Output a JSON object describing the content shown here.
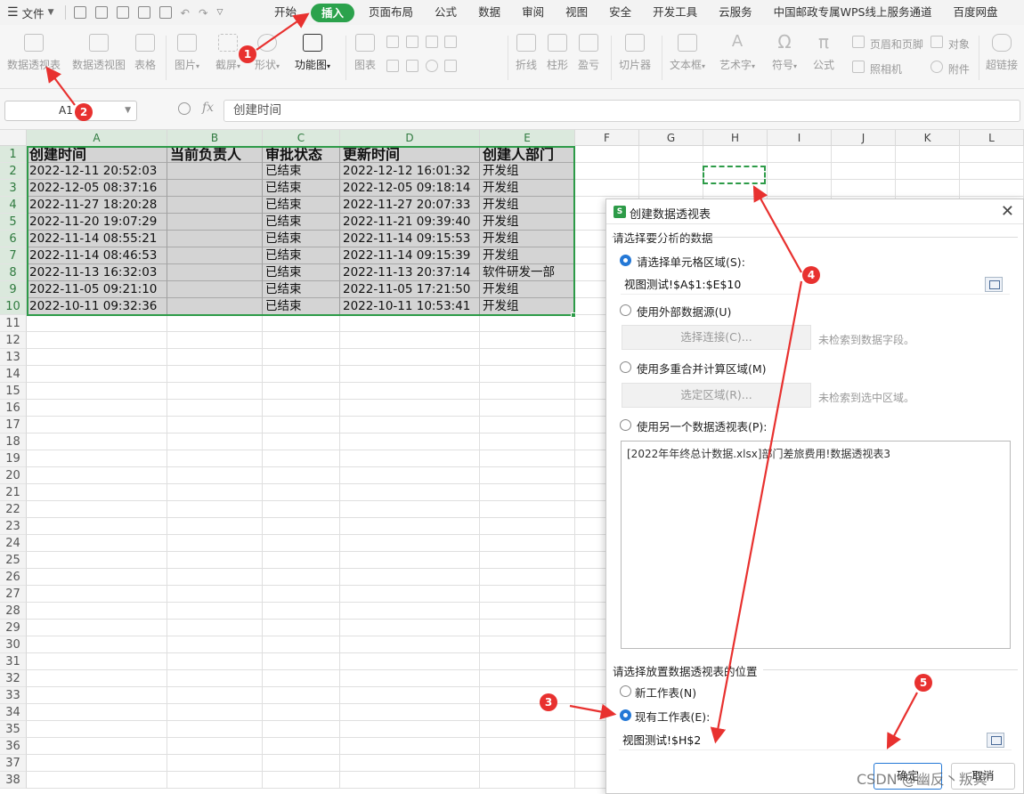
{
  "menubar": {
    "file_label": "文件",
    "tabs": [
      "开始",
      "插入",
      "页面布局",
      "公式",
      "数据",
      "审阅",
      "视图",
      "安全",
      "开发工具",
      "云服务",
      "中国邮政专属WPS线上服务通道",
      "百度网盘"
    ],
    "active_tab": "插入"
  },
  "ribbon": {
    "pivot_table": "数据透视表",
    "pivot_chart": "数据透视图",
    "table": "表格",
    "picture": "图片",
    "screenshot": "截屏",
    "shape": "形状",
    "function_chart": "功能图",
    "chart": "图表",
    "polyline": "折线",
    "column": "柱形",
    "win_loss": "盈亏",
    "slicer": "切片器",
    "textbox": "文本框",
    "wordart": "艺术字",
    "symbol": "符号",
    "formula": "公式",
    "header_footer": "页眉和页脚",
    "camera": "照相机",
    "object": "对象",
    "attachment": "附件",
    "hyperlink": "超链接"
  },
  "formula_bar": {
    "name_box": "A1",
    "fx": "fx",
    "content": "创建时间"
  },
  "sheet": {
    "columns": [
      "A",
      "B",
      "C",
      "D",
      "E",
      "F",
      "G",
      "H",
      "I",
      "J",
      "K",
      "L"
    ],
    "header": [
      "创建时间",
      "当前负责人",
      "审批状态",
      "更新时间",
      "创建人部门"
    ],
    "rows": [
      [
        "2022-12-11 20:52:03",
        "",
        "已结束",
        "2022-12-12 16:01:32",
        "开发组"
      ],
      [
        "2022-12-05 08:37:16",
        "",
        "已结束",
        "2022-12-05 09:18:14",
        "开发组"
      ],
      [
        "2022-11-27 18:20:28",
        "",
        "已结束",
        "2022-11-27 20:07:33",
        "开发组"
      ],
      [
        "2022-11-20 19:07:29",
        "",
        "已结束",
        "2022-11-21 09:39:40",
        "开发组"
      ],
      [
        "2022-11-14 08:55:21",
        "",
        "已结束",
        "2022-11-14 09:15:53",
        "开发组"
      ],
      [
        "2022-11-14 08:46:53",
        "",
        "已结束",
        "2022-11-14 09:15:39",
        "开发组"
      ],
      [
        "2022-11-13 16:32:03",
        "",
        "已结束",
        "2022-11-13 20:37:14",
        "软件研发一部"
      ],
      [
        "2022-11-05 09:21:10",
        "",
        "已结束",
        "2022-11-05 17:21:50",
        "开发组"
      ],
      [
        "2022-10-11 09:32:36",
        "",
        "已结束",
        "2022-10-11 10:53:41",
        "开发组"
      ]
    ],
    "row_numbers": [
      "1",
      "2",
      "3",
      "4",
      "5",
      "6",
      "7",
      "8",
      "9",
      "10",
      "11",
      "12",
      "13",
      "14",
      "15",
      "16",
      "17",
      "18",
      "19",
      "20",
      "21",
      "22",
      "23",
      "24",
      "25",
      "26",
      "27",
      "28",
      "29",
      "30",
      "31",
      "32",
      "33",
      "34",
      "35",
      "36",
      "37",
      "38"
    ]
  },
  "dialog": {
    "title": "创建数据透视表",
    "section1": "请选择要分析的数据",
    "opt_range": "请选择单元格区域(S):",
    "range_value": "视图测试!$A$1:$E$10",
    "opt_external": "使用外部数据源(U)",
    "btn_connect": "选择连接(C)...",
    "hint_connect": "未检索到数据字段。",
    "opt_multi": "使用多重合并计算区域(M)",
    "btn_region": "选定区域(R)...",
    "hint_region": "未检索到选中区域。",
    "opt_other_pivot": "使用另一个数据透视表(P):",
    "pivot_list_item": "[2022年年终总计数据.xlsx]部门差旅费用!数据透视表3",
    "section2": "请选择放置数据透视表的位置",
    "opt_new_sheet": "新工作表(N)",
    "opt_existing_sheet": "现有工作表(E):",
    "location_value": "视图测试!$H$2",
    "ok": "确定",
    "cancel": "取消"
  },
  "annotations": [
    "1",
    "2",
    "3",
    "4",
    "5"
  ],
  "watermark": "CSDN @幽反丶叛冥",
  "colors": {
    "accent_green": "#2ba24c",
    "selection_green": "#2d9b48",
    "annotation_red": "#e8312f",
    "radio_blue": "#2478d6"
  }
}
